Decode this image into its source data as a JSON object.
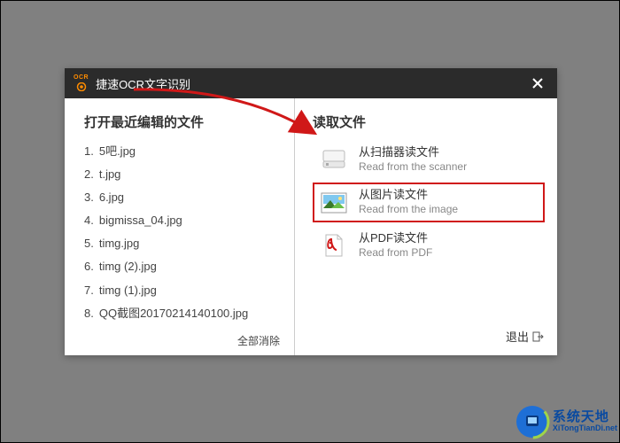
{
  "window": {
    "title": "捷速OCR文字识别",
    "logo_text": "OCR"
  },
  "left": {
    "heading": "打开最近编辑的文件",
    "recent": [
      {
        "idx": "1.",
        "name": "5吧.jpg"
      },
      {
        "idx": "2.",
        "name": "t.jpg"
      },
      {
        "idx": "3.",
        "name": "6.jpg"
      },
      {
        "idx": "4.",
        "name": "bigmissa_04.jpg"
      },
      {
        "idx": "5.",
        "name": "timg.jpg"
      },
      {
        "idx": "6.",
        "name": "timg (2).jpg"
      },
      {
        "idx": "7.",
        "name": "timg (1).jpg"
      },
      {
        "idx": "8.",
        "name": "QQ截图20170214140100.jpg"
      }
    ],
    "clear_label": "全部消除"
  },
  "right": {
    "heading": "读取文件",
    "options": [
      {
        "icon": "scanner",
        "cn": "从扫描器读文件",
        "en": "Read from the scanner"
      },
      {
        "icon": "image",
        "cn": "从图片读文件",
        "en": "Read from the image"
      },
      {
        "icon": "pdf",
        "cn": "从PDF读文件",
        "en": "Read from PDF"
      }
    ],
    "exit_label": "退出"
  },
  "watermark": {
    "big": "系统天地",
    "small": "XiTongTianDi.net"
  }
}
